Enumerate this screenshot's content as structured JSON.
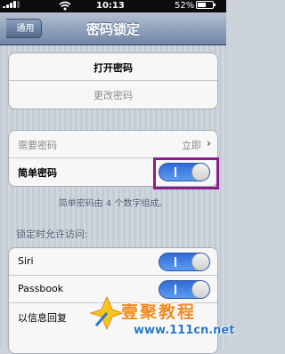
{
  "status_bar": {
    "time": "10:13",
    "battery": "52%"
  },
  "nav": {
    "back_label": "通用",
    "title": "密码锁定"
  },
  "group1": {
    "turn_on": "打开密码",
    "change": "更改密码"
  },
  "group2": {
    "require_label": "需要密码",
    "require_value": "立即",
    "simple_label": "简单密码",
    "simple_on": true
  },
  "simple_footnote": "简单密码由 4 个数字组成。",
  "allow_header": "锁定时允许访问:",
  "group3": {
    "siri": "Siri",
    "passbook": "Passbook",
    "reply": "以信息回复"
  },
  "watermark": {
    "text": "壹聚教程",
    "url": "www.111cn.net"
  },
  "colors": {
    "toggle_on": "#3b7de0",
    "highlight": "#8b1d8b",
    "watermark_orange": "#f08a24",
    "watermark_blue": "#2b78c5"
  }
}
